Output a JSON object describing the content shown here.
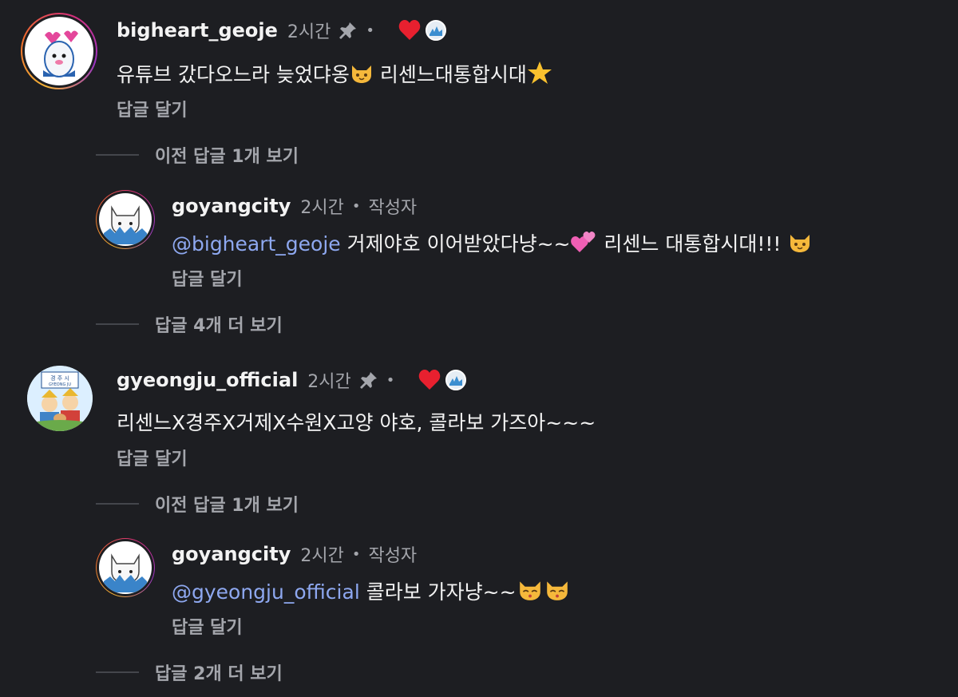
{
  "comments": [
    {
      "username": "bigheart_geoje",
      "time": "2시간",
      "text": "유튜브 갔다오느라 늦었댜옹",
      "text_after_emoji": " 리센느대통합시대",
      "emojis": [
        "cat-face",
        "star"
      ],
      "reply_label": "답글 달기",
      "pinned": true,
      "liked_by_author": true,
      "thread_label": "이전 답글 1개 보기",
      "reply": {
        "username": "goyangcity",
        "time": "2시간",
        "author_badge": "작성자",
        "mention": "@bigheart_geoje",
        "text": " 거제야호 이어받았다냥~~",
        "text_after_emoji": " 리센느 대통합시대!!! ",
        "emojis": [
          "two-hearts",
          "cat-face"
        ],
        "reply_label": "답글 달기"
      },
      "more_label": "답글 4개 더 보기"
    },
    {
      "username": "gyeongju_official",
      "time": "2시간",
      "text": "리센느X경주X거제X수원X고양 야호, 콜라보 가즈아~~~",
      "reply_label": "답글 달기",
      "pinned": true,
      "liked_by_author": true,
      "avatar_sign": "경 주 시",
      "avatar_sign_sub": "GYEONG JU",
      "thread_label": "이전 답글 1개 보기",
      "reply": {
        "username": "goyangcity",
        "time": "2시간",
        "author_badge": "작성자",
        "mention": "@gyeongju_official",
        "text": " 콜라보 가자냥~~",
        "emojis": [
          "kissing-cat",
          "kissing-cat"
        ],
        "reply_label": "답글 달기"
      },
      "more_label": "답글 2개 더 보기"
    }
  ],
  "colors": {
    "background": "#1d1e22",
    "mention": "#8ea8f0",
    "secondary_text": "#a4a6ac",
    "heart": "#e8202f"
  },
  "separator": "•"
}
